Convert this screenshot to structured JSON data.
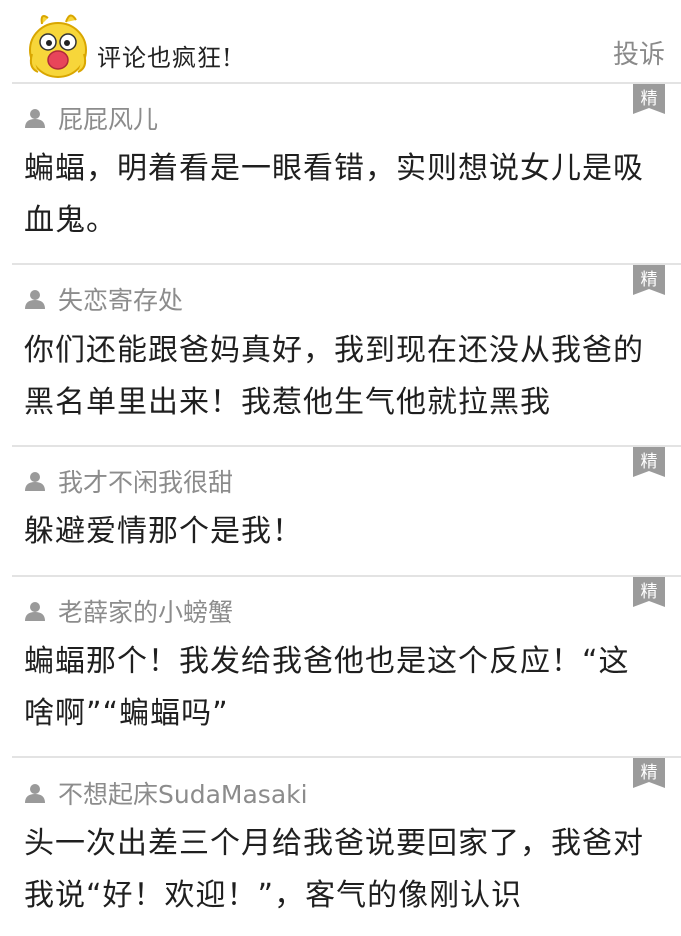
{
  "header": {
    "title": "评论也疯狂!",
    "report_label": "投诉"
  },
  "badge_label": "精",
  "comments": [
    {
      "username": "屁屁风儿",
      "text": "蝙蝠，明着看是一眼看错，实则想说女儿是吸血鬼。"
    },
    {
      "username": "失恋寄存处",
      "text": "你们还能跟爸妈真好，我到现在还没从我爸的黑名单里出来！我惹他生气他就拉黑我"
    },
    {
      "username": "我才不闲我很甜",
      "text": "躲避爱情那个是我！"
    },
    {
      "username": "老薛家的小螃蟹",
      "text": "蝙蝠那个！我发给我爸他也是这个反应！“这啥啊”“蝙蝠吗”"
    },
    {
      "username": "不想起床SudaMasaki",
      "text": "头一次出差三个月给我爸说要回家了，我爸对我说“好！欢迎！”，客气的像刚认识"
    }
  ]
}
